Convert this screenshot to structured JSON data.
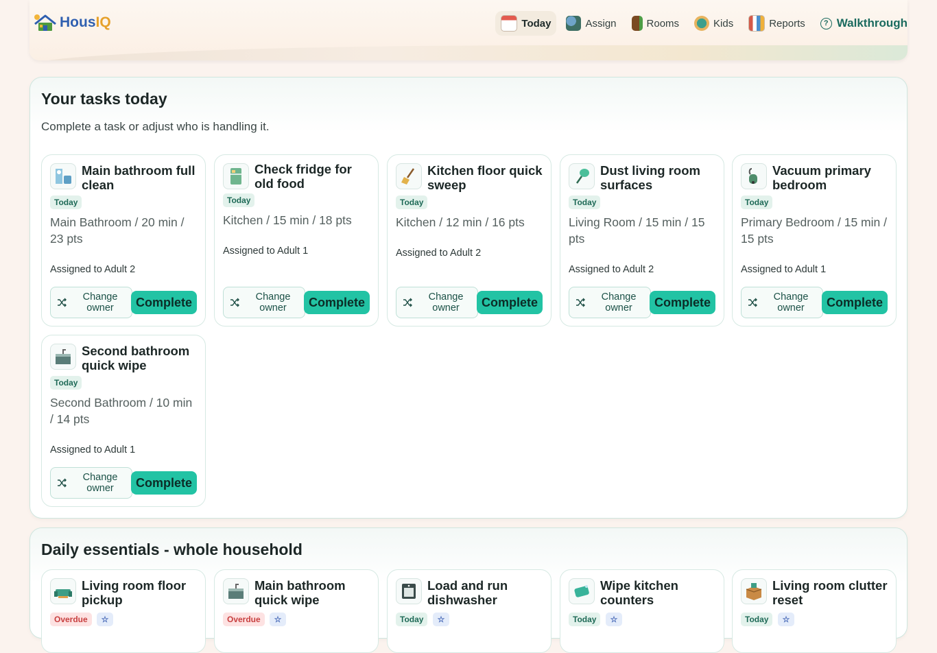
{
  "app": {
    "logo_part1": "Hous",
    "logo_part2": "IQ"
  },
  "nav": {
    "items": [
      {
        "label": "Today",
        "icon": "calendar-icon",
        "active": true
      },
      {
        "label": "Assign",
        "icon": "assign-icon",
        "active": false
      },
      {
        "label": "Rooms",
        "icon": "door-icon",
        "active": false
      },
      {
        "label": "Kids",
        "icon": "kids-icon",
        "active": false
      },
      {
        "label": "Reports",
        "icon": "reports-icon",
        "active": false
      }
    ],
    "walkthrough": "Walkthrough"
  },
  "tasks_section": {
    "title": "Your tasks today",
    "subtitle": "Complete a task or adjust who is handling it.",
    "change_owner_label": "Change owner",
    "complete_label": "Complete",
    "cards": [
      {
        "title": "Main bathroom full clean",
        "badge": "Today",
        "meta": "Main Bathroom / 20 min / 23 pts",
        "assigned": "Assigned to Adult 2",
        "icon": "bathroom-icon"
      },
      {
        "title": "Check fridge for old food",
        "badge": "Today",
        "meta": "Kitchen / 15 min / 18 pts",
        "assigned": "Assigned to Adult 1",
        "icon": "fridge-icon"
      },
      {
        "title": "Kitchen floor quick sweep",
        "badge": "Today",
        "meta": "Kitchen / 12 min / 16 pts",
        "assigned": "Assigned to Adult 2",
        "icon": "broom-icon"
      },
      {
        "title": "Dust living room surfaces",
        "badge": "Today",
        "meta": "Living Room / 15 min / 15 pts",
        "assigned": "Assigned to Adult 2",
        "icon": "duster-icon"
      },
      {
        "title": "Vacuum primary bedroom",
        "badge": "Today",
        "meta": "Primary Bedroom / 15 min / 15 pts",
        "assigned": "Assigned to Adult 1",
        "icon": "vacuum-icon"
      },
      {
        "title": "Second bathroom quick wipe",
        "badge": "Today",
        "meta": "Second Bathroom / 10 min / 14 pts",
        "assigned": "Assigned to Adult 1",
        "icon": "sink-icon"
      }
    ]
  },
  "essentials_section": {
    "title": "Daily essentials - whole household",
    "cards": [
      {
        "title": "Living room floor pickup",
        "badge": "Overdue",
        "icon": "sofa-icon"
      },
      {
        "title": "Main bathroom quick wipe",
        "badge": "Overdue",
        "icon": "sink-icon"
      },
      {
        "title": "Load and run dishwasher",
        "badge": "Today",
        "icon": "dishwasher-icon"
      },
      {
        "title": "Wipe kitchen counters",
        "badge": "Today",
        "icon": "sponge-icon"
      },
      {
        "title": "Living room clutter reset",
        "badge": "Today",
        "icon": "box-icon"
      }
    ],
    "star_badge": "☆"
  },
  "colors": {
    "accent": "#22c3a4",
    "brand_blue": "#2f5fb0",
    "brand_orange": "#e6a12b",
    "overdue": "#c84040"
  }
}
